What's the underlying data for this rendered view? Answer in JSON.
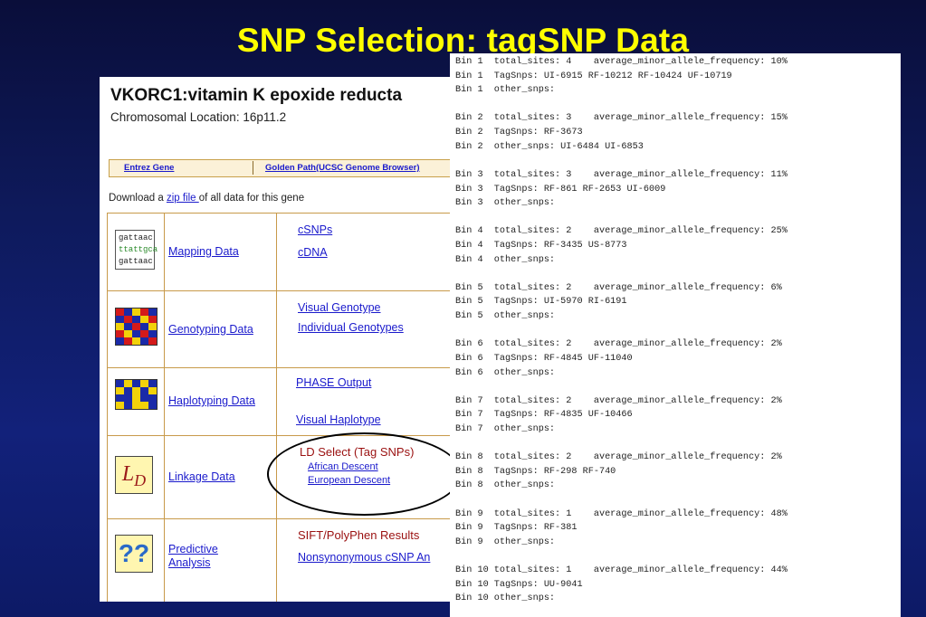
{
  "slide": {
    "title": "SNP Selection:  tagSNP Data"
  },
  "gene_page": {
    "gene_title": "VKORC1:vitamin K epoxide reducta",
    "chromosomal_location": "Chromosomal Location: 16p11.2",
    "nav": {
      "entrez_gene": "Entrez Gene",
      "golden_path": "Golden Path(UCSC Genome Browser)"
    },
    "download": {
      "prefix": "Download a ",
      "link": "zip file ",
      "suffix": "of all data for this gene"
    },
    "rows": [
      {
        "category": "Mapping Data",
        "icon": "gattaac-sequence-icon",
        "icon_text": [
          "gattaac",
          "ttattgca",
          "gattaac"
        ],
        "links": [
          "cSNPs",
          "cDNA"
        ]
      },
      {
        "category": "Genotyping Data",
        "icon": "genotype-mosaic-icon",
        "links": [
          "Visual Genotype",
          "Individual Genotypes"
        ]
      },
      {
        "category": "Haplotyping Data",
        "icon": "haplotype-mosaic-icon",
        "links": [
          "PHASE Output",
          "Visual Haplotype"
        ]
      },
      {
        "category": "Linkage Data",
        "icon": "ld-icon",
        "icon_text": "L",
        "icon_sub": "D",
        "heading": "LD Select (Tag SNPs)",
        "links": [
          "African Descent",
          "European Descent"
        ]
      },
      {
        "category_line1": "Predictive",
        "category_line2": "Analysis",
        "icon": "question-marks-icon",
        "icon_text": "??",
        "heading": "SIFT/PolyPhen Results",
        "links": [
          "Nonsynonymous cSNP An"
        ]
      }
    ],
    "colors": {
      "link": "#1a1acc",
      "heading_red": "#9a1010",
      "border": "#c89a4a"
    }
  },
  "bins": [
    [
      "Bin 1  total_sites: 4    average_minor_allele_frequency: 10%",
      "Bin 1  TagSnps: UI-6915 RF-10212 RF-10424 UF-10719",
      "Bin 1  other_snps:"
    ],
    [
      "Bin 2  total_sites: 3    average_minor_allele_frequency: 15%",
      "Bin 2  TagSnps: RF-3673",
      "Bin 2  other_snps: UI-6484 UI-6853"
    ],
    [
      "Bin 3  total_sites: 3    average_minor_allele_frequency: 11%",
      "Bin 3  TagSnps: RF-861 RF-2653 UI-6009",
      "Bin 3  other_snps:"
    ],
    [
      "Bin 4  total_sites: 2    average_minor_allele_frequency: 25%",
      "Bin 4  TagSnps: RF-3435 US-8773",
      "Bin 4  other_snps:"
    ],
    [
      "Bin 5  total_sites: 2    average_minor_allele_frequency: 6%",
      "Bin 5  TagSnps: UI-5970 RI-6191",
      "Bin 5  other_snps:"
    ],
    [
      "Bin 6  total_sites: 2    average_minor_allele_frequency: 2%",
      "Bin 6  TagSnps: RF-4845 UF-11040",
      "Bin 6  other_snps:"
    ],
    [
      "Bin 7  total_sites: 2    average_minor_allele_frequency: 2%",
      "Bin 7  TagSnps: RF-4835 UF-10466",
      "Bin 7  other_snps:"
    ],
    [
      "Bin 8  total_sites: 2    average_minor_allele_frequency: 2%",
      "Bin 8  TagSnps: RF-298 RF-740",
      "Bin 8  other_snps:"
    ],
    [
      "Bin 9  total_sites: 1    average_minor_allele_frequency: 48%",
      "Bin 9  TagSnps: RF-381",
      "Bin 9  other_snps:"
    ],
    [
      "Bin 10 total_sites: 1    average_minor_allele_frequency: 44%",
      "Bin 10 TagSnps: UU-9041",
      "Bin 10 other_snps:"
    ]
  ]
}
